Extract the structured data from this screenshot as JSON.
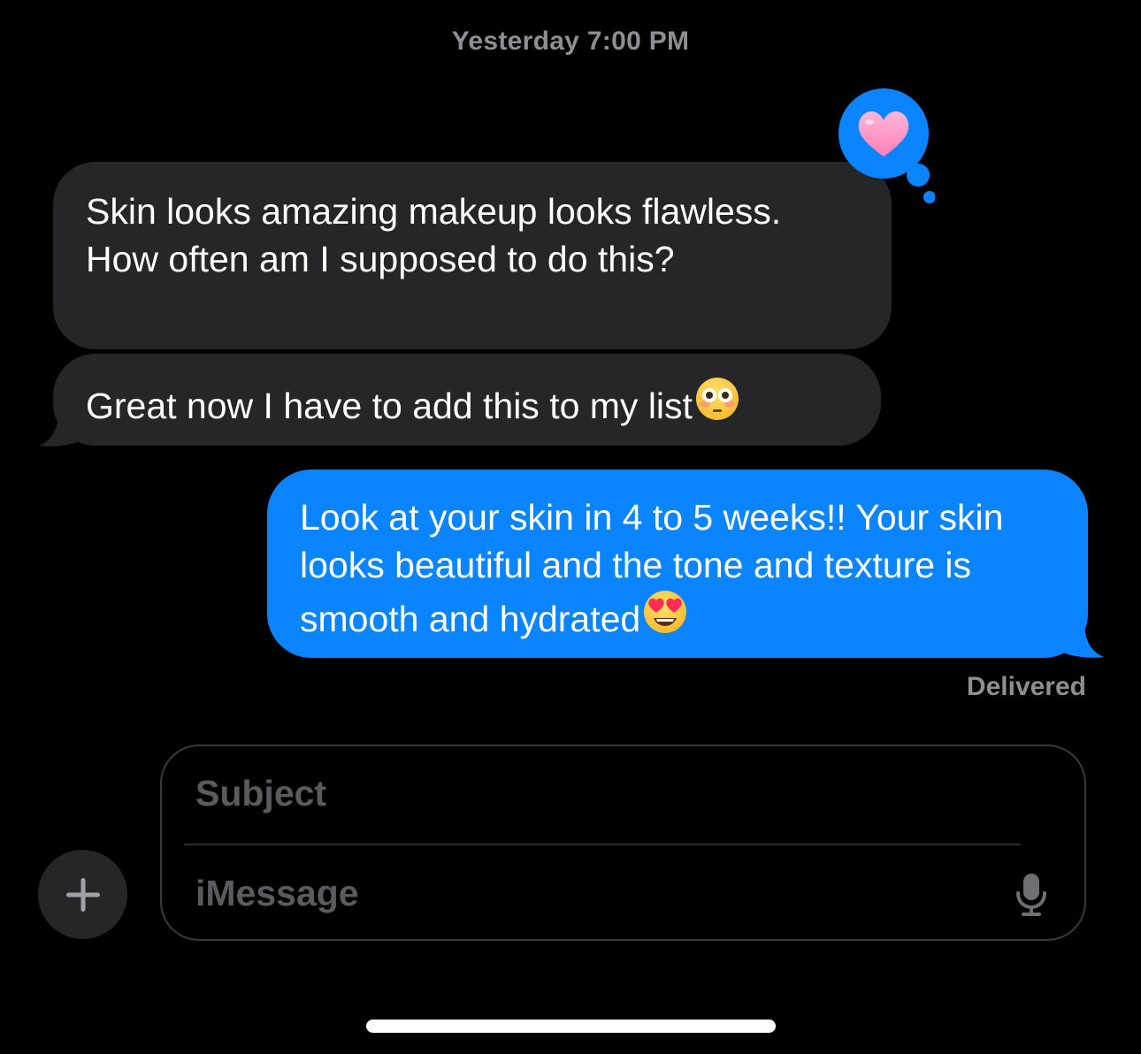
{
  "timestamp": {
    "day": "Yesterday",
    "time": "7:00 PM"
  },
  "messages": [
    {
      "direction": "incoming",
      "text": "Skin looks amazing makeup looks flawless. How often am I supposed to do this?",
      "reaction": "heart"
    },
    {
      "direction": "incoming",
      "text": "Great now I have to add this to my list",
      "emoji": "flushed-face"
    },
    {
      "direction": "outgoing",
      "text": "Look at your skin in 4 to 5 weeks!!  Your skin looks  beautiful and the tone and texture is smooth and hydrated",
      "emoji": "heart-eyes-face"
    }
  ],
  "status": {
    "delivered_label": "Delivered"
  },
  "composer": {
    "subject_placeholder": "Subject",
    "message_placeholder": "iMessage"
  },
  "colors": {
    "background": "#000000",
    "incoming_bubble": "#262628",
    "outgoing_bubble": "#0a84ff",
    "secondary_text": "#8e8e93"
  }
}
